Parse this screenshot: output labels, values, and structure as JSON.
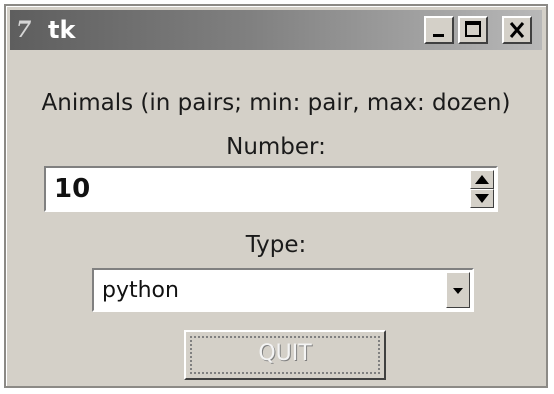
{
  "window": {
    "title": "tk",
    "app_icon": "7",
    "controls": {
      "minimize_icon": "minimize-icon",
      "maximize_icon": "maximize-icon",
      "close_icon": "close-icon"
    }
  },
  "form": {
    "heading": "Animals (in pairs; min: pair, max: dozen)",
    "number_label": "Number:",
    "number_value": "10",
    "type_label": "Type:",
    "type_value": "python",
    "quit_label": "QUIT"
  },
  "colors": {
    "window_bg": "#d4d0c8",
    "titlebar_start": "#5e5e5e",
    "titlebar_end": "#b8b8b8",
    "field_bg": "#ffffff"
  }
}
